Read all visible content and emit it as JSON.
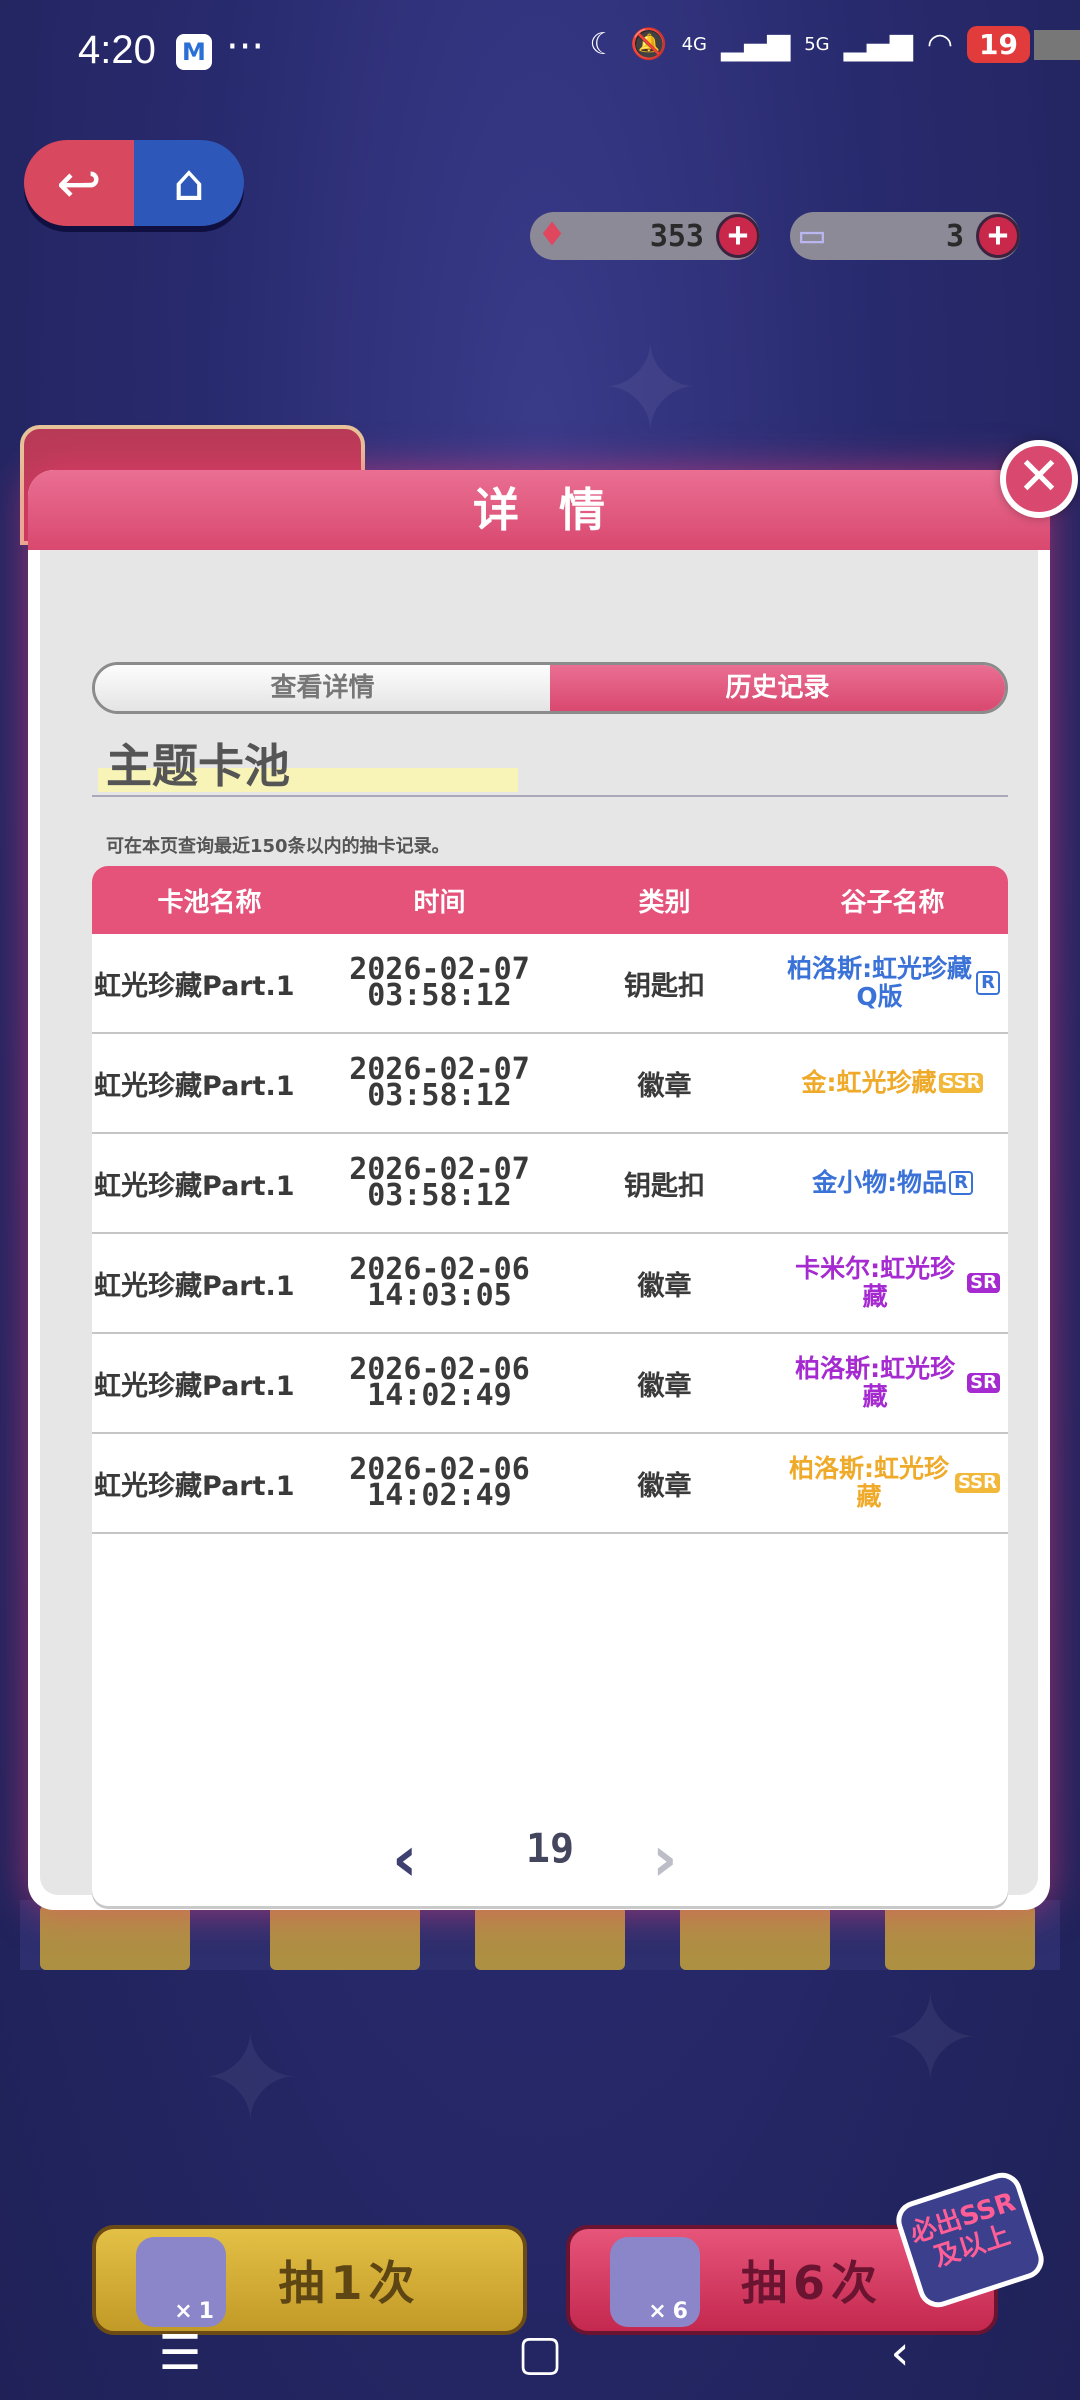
{
  "status_bar": {
    "time": "4:20",
    "app_icon": "M",
    "more": "···",
    "signal_4g": "4G",
    "signal_5g": "5G",
    "battery": "19"
  },
  "currency": {
    "gems": "353",
    "tickets": "3"
  },
  "modal": {
    "title": "详情",
    "close": "✕",
    "tabs": {
      "details": "查看详情",
      "history": "历史记录"
    },
    "section_title": "主题卡池",
    "hint": "可在本页查询最近150条以内的抽卡记录。",
    "table": {
      "headers": [
        "卡池名称",
        "时间",
        "类别",
        "谷子名称"
      ],
      "rows": [
        {
          "pool": "虹光珍藏Part.1",
          "date": "2026-02-07",
          "time": "03:58:12",
          "category": "钥匙扣",
          "item": "柏洛斯:虹光珍藏Q版",
          "rarity": "R"
        },
        {
          "pool": "虹光珍藏Part.1",
          "date": "2026-02-07",
          "time": "03:58:12",
          "category": "徽章",
          "item": "金:虹光珍藏",
          "rarity": "SSR"
        },
        {
          "pool": "虹光珍藏Part.1",
          "date": "2026-02-07",
          "time": "03:58:12",
          "category": "钥匙扣",
          "item": "金小物:物品",
          "rarity": "R"
        },
        {
          "pool": "虹光珍藏Part.1",
          "date": "2026-02-06",
          "time": "14:03:05",
          "category": "徽章",
          "item": "卡米尔:虹光珍藏",
          "rarity": "SR"
        },
        {
          "pool": "虹光珍藏Part.1",
          "date": "2026-02-06",
          "time": "14:02:49",
          "category": "徽章",
          "item": "柏洛斯:虹光珍藏",
          "rarity": "SR"
        },
        {
          "pool": "虹光珍藏Part.1",
          "date": "2026-02-06",
          "time": "14:02:49",
          "category": "徽章",
          "item": "柏洛斯:虹光珍藏",
          "rarity": "SSR"
        }
      ]
    },
    "pagination": {
      "page": "19"
    }
  },
  "draw_buttons": {
    "single": "抽1次",
    "single_count": "×1",
    "multi": "抽6次",
    "multi_count": "×6",
    "ssr_badge": "必出SSR及以上"
  },
  "icons": {
    "back": "back-arrow-icon",
    "home": "home-icon",
    "gem": "gem-icon",
    "ticket": "ticket-icon",
    "prev": "chevron-left-icon",
    "next": "chevron-right-icon"
  },
  "colors": {
    "accent_pink": "#e5527a",
    "rarity_r": "#3a72d8",
    "rarity_sr": "#a52bd1",
    "rarity_ssr": "#efaa2a"
  }
}
